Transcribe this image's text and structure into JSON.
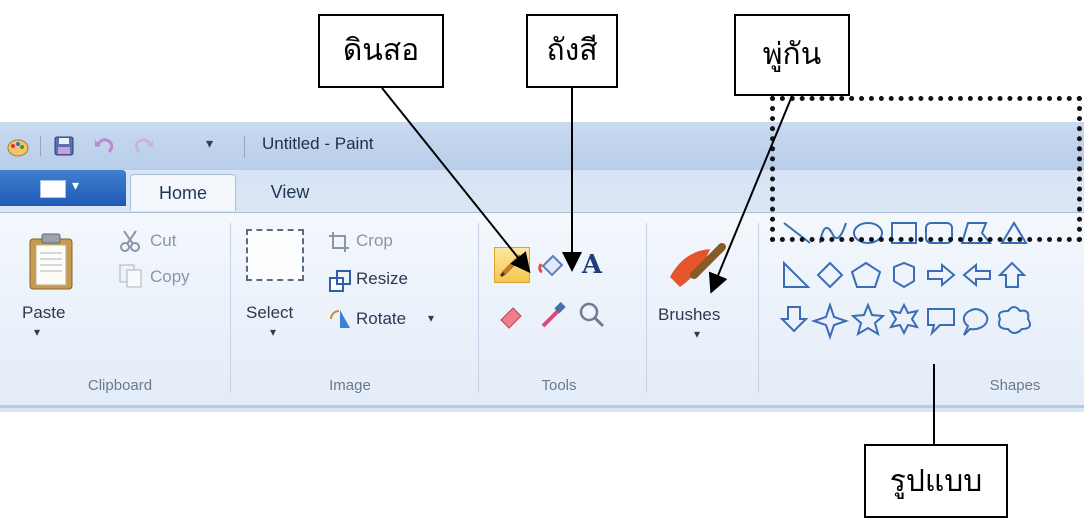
{
  "window": {
    "title": "Untitled - Paint",
    "quick_access": [
      "paint-app-icon",
      "save-icon",
      "undo-icon",
      "redo-icon",
      "customize-dropdown-icon"
    ]
  },
  "tabs": [
    {
      "label": "Home",
      "active": true
    },
    {
      "label": "View",
      "active": false
    }
  ],
  "ribbon": {
    "clipboard": {
      "paste_label": "Paste",
      "cut_label": "Cut",
      "copy_label": "Copy",
      "group_label": "Clipboard"
    },
    "image": {
      "select_label": "Select",
      "crop_label": "Crop",
      "resize_label": "Resize",
      "rotate_label": "Rotate",
      "group_label": "Image"
    },
    "tools": {
      "items": [
        "pencil-icon",
        "fill-bucket-icon",
        "text-icon",
        "eraser-icon",
        "color-picker-icon",
        "magnifier-icon"
      ],
      "text_glyph": "A",
      "group_label": "Tools"
    },
    "brushes": {
      "label": "Brushes"
    },
    "shapes": {
      "group_label": "Shapes"
    }
  },
  "callouts": {
    "pencil": "ดินสอ",
    "fill": "ถังสี",
    "brush": "พู่กัน",
    "shapes": "รูปแบบ"
  },
  "colors": {
    "accent": "#1f5bb5",
    "ribbon_bg": "#eef3fa",
    "selected_tool": "#f6c64e"
  }
}
